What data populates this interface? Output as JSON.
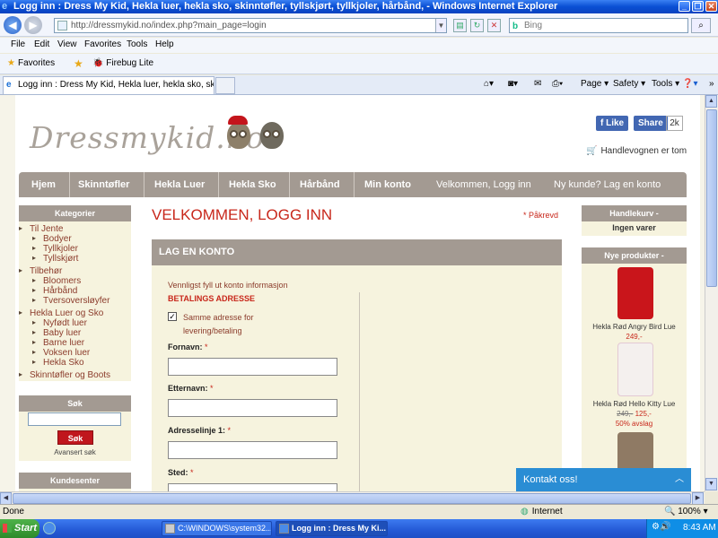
{
  "window": {
    "title": "Logg inn : Dress My Kid, Hekla luer, hekla sko, skinntøfler, tyllskjørt, tyllkjoler, hårbånd, - Windows Internet Explorer"
  },
  "browser": {
    "url": "http://dressmykid.no/index.php?main_page=login",
    "search_placeholder": "Bing",
    "menu": [
      "File",
      "Edit",
      "View",
      "Favorites",
      "Tools",
      "Help"
    ],
    "favorites_label": "Favorites",
    "firebug_label": "Firebug Lite",
    "tab_title": "Logg inn : Dress My Kid, Hekla luer, hekla sko, skinntø...",
    "commands": [
      "Page ▾",
      "Safety ▾",
      "Tools ▾"
    ]
  },
  "site": {
    "logo_text": "Dressmykid.no",
    "facebook": {
      "like": "Like",
      "share": "Share",
      "count": "2k"
    },
    "cart_status": "Handlevognen er tom",
    "nav": [
      "Hjem",
      "Skinntøfler",
      "Hekla Luer",
      "Hekla Sko",
      "Hårbånd",
      "Min konto"
    ],
    "nav_right": [
      "Velkommen, Logg inn",
      "Ny kunde? Lag en konto"
    ],
    "categories_title": "Kategorier",
    "categories": [
      {
        "label": "Til Jente",
        "level": 0
      },
      {
        "label": "Bodyer",
        "level": 1
      },
      {
        "label": "Tyllkjoler",
        "level": 1
      },
      {
        "label": "Tyllskjørt",
        "level": 1
      },
      {
        "label": "Tilbehør",
        "level": 0
      },
      {
        "label": "Bloomers",
        "level": 1
      },
      {
        "label": "Hårbånd",
        "level": 1
      },
      {
        "label": "Tversoversløyfer",
        "level": 1
      },
      {
        "label": "Hekla Luer og Sko",
        "level": 0
      },
      {
        "label": "Nyfødt luer",
        "level": 1
      },
      {
        "label": "Baby luer",
        "level": 1
      },
      {
        "label": "Barne luer",
        "level": 1
      },
      {
        "label": "Voksen luer",
        "level": 1
      },
      {
        "label": "Hekla Sko",
        "level": 1
      },
      {
        "label": "Skinntøfler og Boots",
        "level": 0
      }
    ],
    "search": {
      "title": "Søk",
      "button": "Søk",
      "advanced": "Avansert søk"
    },
    "customer_center": "Kundesenter",
    "page_heading": "VELKOMMEN, LOGG INN",
    "required_note": "* Påkrevd",
    "create_account_title": "LAG EN KONTO",
    "form": {
      "intro": "Vennligst fyll ut konto informasjon",
      "billing_heading": "BETALINGS ADRESSE",
      "same_address_label": "Samme adresse for levering/betaling",
      "same_address_checked": true,
      "fields": [
        {
          "label": "Fornavn:",
          "value": ""
        },
        {
          "label": "Etternavn:",
          "value": ""
        },
        {
          "label": "Adresselinje 1:",
          "value": ""
        },
        {
          "label": "Sted:",
          "value": ""
        }
      ],
      "required_mark": "*"
    },
    "cart_box": {
      "title": "Handlekurv -",
      "status": "Ingen varer"
    },
    "new_products": {
      "title": "Nye produkter -",
      "items": [
        {
          "name": "Hekla Rød Angry Bird Lue",
          "price": "249,-",
          "old_price": "",
          "discount": "",
          "color": "#c9151b"
        },
        {
          "name": "Hekla Rød Hello Kitty Lue",
          "price": "125,-",
          "old_price": "249,-",
          "discount": "50% avslag",
          "color": "#f4f0ee"
        },
        {
          "name": "",
          "price": "",
          "old_price": "",
          "discount": "",
          "color": "#8f7a64"
        }
      ]
    },
    "chat_label": "Kontakt oss!"
  },
  "status": {
    "text": "Done",
    "zone": "Internet",
    "zoom": "100%"
  },
  "taskbar": {
    "start": "Start",
    "tasks": [
      "C:\\WINDOWS\\system32....",
      "Logg inn : Dress My Ki..."
    ],
    "clock": "8:43 AM"
  },
  "colors": {
    "accent_red": "#c8271b",
    "nav_bg": "#a39a92",
    "panel_bg": "#f6f3de",
    "chat_blue": "#2a8dd4"
  }
}
